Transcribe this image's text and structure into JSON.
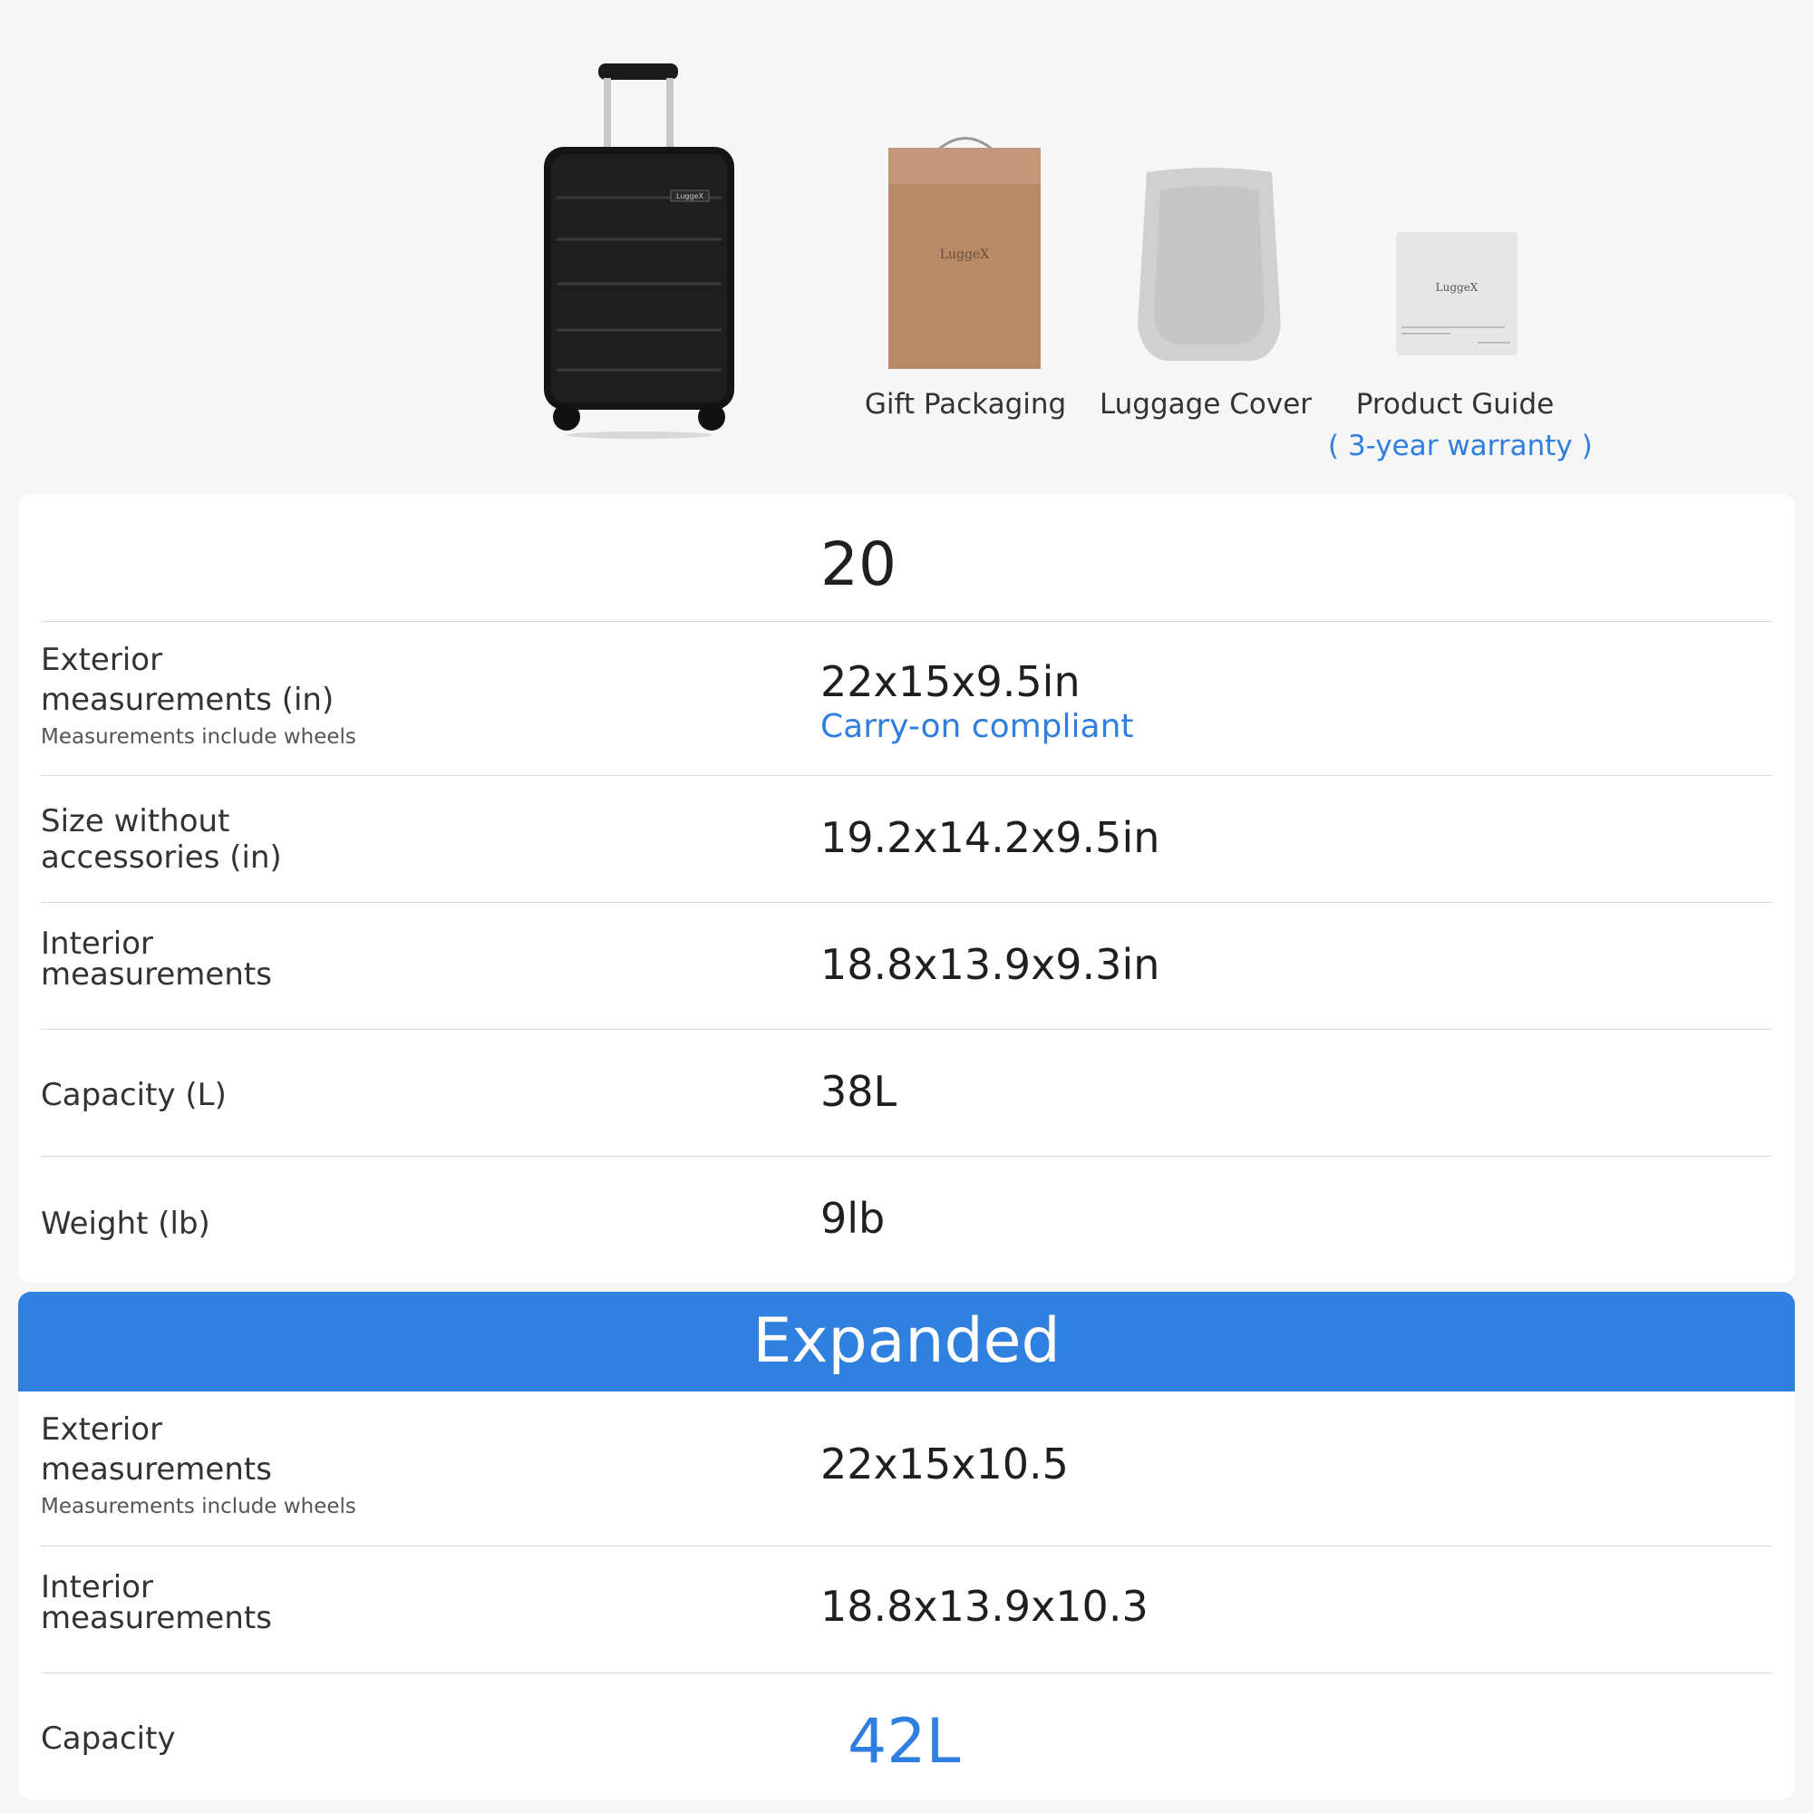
{
  "accessories": {
    "suitcase_logo": "LuggeX",
    "items": [
      {
        "label": "Gift Packaging",
        "logo": "LuggeX"
      },
      {
        "label": "Luggage Cover"
      },
      {
        "label": "Product Guide",
        "sub": "( 3-year warranty )",
        "logo": "LuggeX"
      }
    ]
  },
  "specs": {
    "size_header": "20",
    "rows": [
      {
        "label": "Exterior measurements (in)",
        "note": "Measurements include wheels",
        "value": "22x15x9.5in",
        "value_note": "Carry-on compliant"
      },
      {
        "label": "Size without accessories (in)",
        "value": "19.2x14.2x9.5in"
      },
      {
        "label": "Interior measurements",
        "value": "18.8x13.9x9.3in"
      },
      {
        "label": "Capacity (L)",
        "value": "38L"
      },
      {
        "label": "Weight (lb)",
        "value": "9lb"
      }
    ]
  },
  "expanded": {
    "title": "Expanded",
    "rows": [
      {
        "label": "Exterior measurements",
        "note": "Measurements include wheels",
        "value": "22x15x10.5"
      },
      {
        "label": "Interior measurements",
        "value": "18.8x13.9x10.3"
      },
      {
        "label": "Capacity",
        "value": "42L"
      }
    ]
  },
  "colors": {
    "accent": "#2f7ee0",
    "banner": "#3080e0",
    "background": "#f6f6f6"
  }
}
